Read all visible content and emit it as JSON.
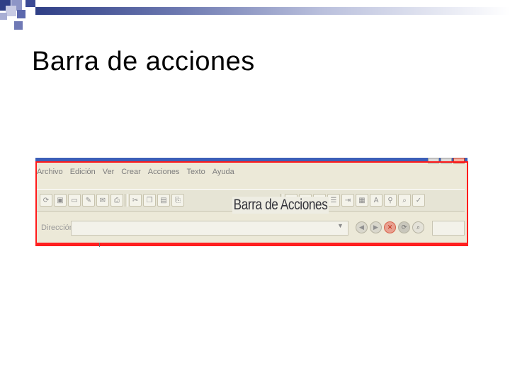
{
  "slide": {
    "title": "Barra de acciones",
    "accent_colors": {
      "title_bar": "#2f3f86",
      "highlight": "#ff1a1a"
    }
  },
  "app": {
    "menu": [
      "Archivo",
      "Edición",
      "Ver",
      "Crear",
      "Acciones",
      "Texto",
      "Ayuda"
    ],
    "caption": "Barra de Acciones",
    "address": {
      "label": "Dirección",
      "value": ""
    },
    "toolbar_icons": [
      "refresh-icon",
      "save-icon",
      "open-folder-icon",
      "edit-icon",
      "email-icon",
      "print-icon",
      "cut-icon",
      "copy-icon",
      "paste-icon",
      "attach-icon",
      "bold-icon",
      "italic-icon",
      "align-icon",
      "list-icon",
      "indent-icon",
      "table-icon",
      "text-color-icon",
      "link-icon",
      "find-icon",
      "spellcheck-icon"
    ],
    "nav_icons": [
      "back-icon",
      "forward-icon",
      "stop-icon",
      "reload-icon",
      "search-icon"
    ]
  }
}
